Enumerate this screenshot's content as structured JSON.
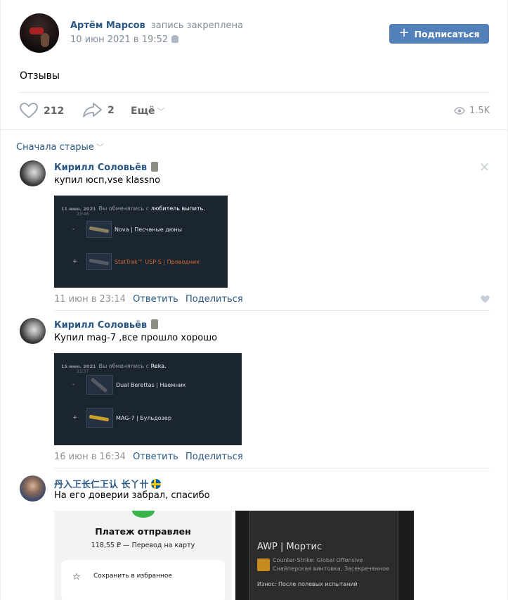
{
  "post": {
    "author_name": "Артём Марсов",
    "pinned_label": "запись закреплена",
    "date": "10 июн 2021 в 19:52",
    "subscribe_label": "Подписаться",
    "text": "Отзывы",
    "likes": "212",
    "shares": "2",
    "more_label": "Ещё",
    "views": "1.5K"
  },
  "comments_sort": "Сначала старые",
  "comments": [
    {
      "author": "Кирилл Соловьёв",
      "text": "купил юсп,vse klassno",
      "date": "11 июн в 23:14",
      "reply": "Ответить",
      "share": "Поделиться",
      "trade": {
        "date": "11 июн. 2021",
        "time": "23:46",
        "message": "Вы обменялись с",
        "partner": "любитель выпить.",
        "give_sign": "-",
        "give_item": "Nova | Песчаные дюны",
        "get_sign": "+",
        "get_item": "StatTrak™ USP-S | Проводник"
      }
    },
    {
      "author": "Кирилл Соловьёв",
      "text": "Купил mag-7 ,все прошло хорошо",
      "date": "16 июн в 16:34",
      "reply": "Ответить",
      "share": "Поделиться",
      "trade": {
        "date": "15 июн. 2021",
        "time": "23:37",
        "message": "Вы обменялись с",
        "partner": "Reka.",
        "give_sign": "-",
        "give_item": "Dual Berettas | Наемник",
        "get_sign": "+",
        "get_item": "MAG-7 | Бульдозер"
      }
    },
    {
      "author": "丹入㠪长仁㠪认 长丫卄",
      "text": "На его доверии забрал, спасибо",
      "photo_payment": {
        "title": "Платеж отправлен",
        "amount": "118,55 ₽ — Перевод на карту",
        "action": "Сохранить в избранное"
      },
      "photo_item": {
        "title": "AWP | Мортис",
        "game": "Counter-Strike: Global Offensive",
        "type": "Снайперская винтовка, Засекреченное",
        "wear": "Износ: После полевых испытаний"
      }
    }
  ],
  "colors": {
    "link": "#2a5885",
    "button": "#5181b8",
    "muted": "#939393",
    "steam_bg": "#1b2530",
    "stattrak": "#cf6a32"
  }
}
